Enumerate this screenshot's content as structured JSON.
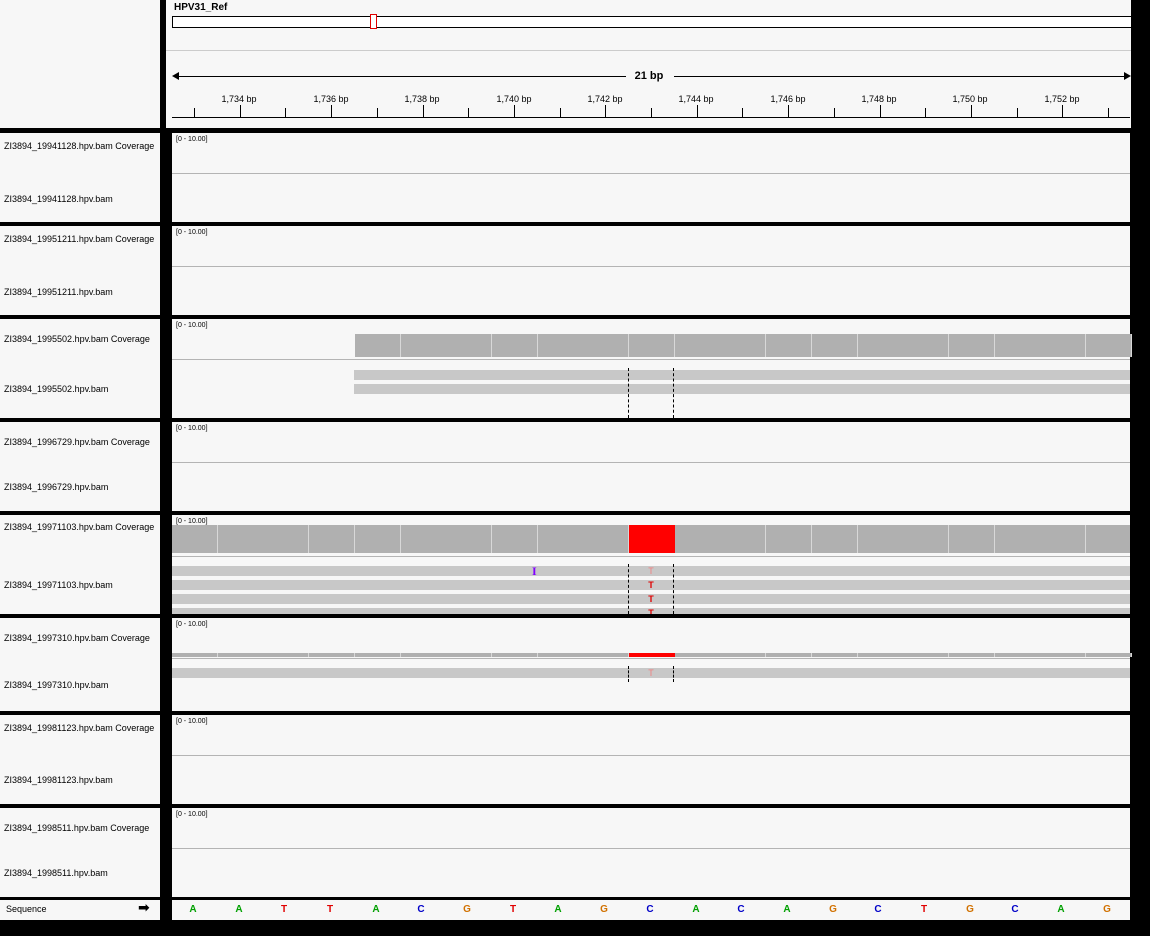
{
  "header": {
    "genome_label": "HPV31_Ref",
    "span_label": "21 bp",
    "ticks": [
      "1,734 bp",
      "1,736 bp",
      "1,738 bp",
      "1,740 bp",
      "1,742 bp",
      "1,744 bp",
      "1,746 bp",
      "1,748 bp",
      "1,750 bp",
      "1,752 bp"
    ]
  },
  "tracks": [
    {
      "coverage_label": "ZI3894_19941128.hpv.bam Coverage",
      "bam_label": "ZI3894_19941128.hpv.bam",
      "range": "[0 - 10.00]"
    },
    {
      "coverage_label": "ZI3894_19951211.hpv.bam Coverage",
      "bam_label": "ZI3894_19951211.hpv.bam",
      "range": "[0 - 10.00]"
    },
    {
      "coverage_label": "ZI3894_1995502.hpv.bam Coverage",
      "bam_label": "ZI3894_1995502.hpv.bam",
      "range": "[0 - 10.00]"
    },
    {
      "coverage_label": "ZI3894_1996729.hpv.bam Coverage",
      "bam_label": "ZI3894_1996729.hpv.bam",
      "range": "[0 - 10.00]"
    },
    {
      "coverage_label": "ZI3894_19971103.hpv.bam Coverage",
      "bam_label": "ZI3894_19971103.hpv.bam",
      "range": "[0 - 10.00]"
    },
    {
      "coverage_label": "ZI3894_1997310.hpv.bam Coverage",
      "bam_label": "ZI3894_1997310.hpv.bam",
      "range": "[0 - 10.00]"
    },
    {
      "coverage_label": "ZI3894_19981123.hpv.bam Coverage",
      "bam_label": "ZI3894_19981123.hpv.bam",
      "range": "[0 - 10.00]"
    },
    {
      "coverage_label": "ZI3894_1998511.hpv.bam Coverage",
      "bam_label": "ZI3894_1998511.hpv.bam",
      "range": "[0 - 10.00]"
    }
  ],
  "mismatch_base": "T",
  "insertion_marker": "I",
  "sequence": {
    "label": "Sequence",
    "arrow": "➡",
    "bases": [
      "A",
      "A",
      "T",
      "T",
      "A",
      "C",
      "G",
      "T",
      "A",
      "G",
      "C",
      "A",
      "C",
      "A",
      "G",
      "C",
      "T",
      "G",
      "C",
      "A",
      "G"
    ]
  },
  "colors": {
    "A": "#00a000",
    "C": "#0000c8",
    "G": "#d17100",
    "T": "#e00000",
    "mismatch": "#ff0000",
    "coverage": "#b0b0b0",
    "read": "#c8c8c8",
    "insertion": "#8000ff"
  }
}
